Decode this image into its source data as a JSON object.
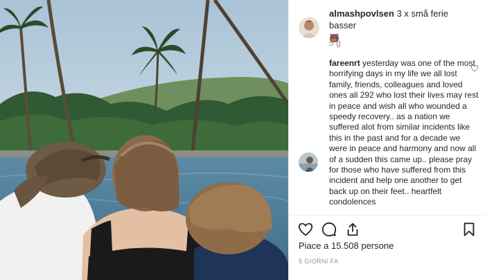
{
  "post": {
    "photo_description": "Family at infinity pool with palm trees"
  },
  "caption": {
    "username": "almashpovlsen",
    "text": "3 x små ferie basser",
    "emoji": "🐻"
  },
  "time_meta": "5 g",
  "comment": {
    "username": "fareenrt",
    "text": "yesterday was one of the most horrifying days in my life we all lost family, friends, colleagues and loved ones all 292 who lost their lives may rest in peace and wish all who wounded a speedy recovery.. as a nation we suffered alot from similar incidents like this in the past and for a decade we were in peace and harmony and now all of a sudden this came up.. please pray for those who have suffered from this incident and help one another to get back up on their feet.. heartfelt condolences"
  },
  "likes_text": "Piace a 15.508 persone",
  "post_date": "5 GIORNI FA",
  "icons": {
    "like": "heart-icon",
    "comment": "comment-icon",
    "share": "share-icon",
    "save": "bookmark-icon"
  },
  "colors": {
    "text": "#262626",
    "secondary": "#8e8e8e",
    "border": "#efefef"
  }
}
